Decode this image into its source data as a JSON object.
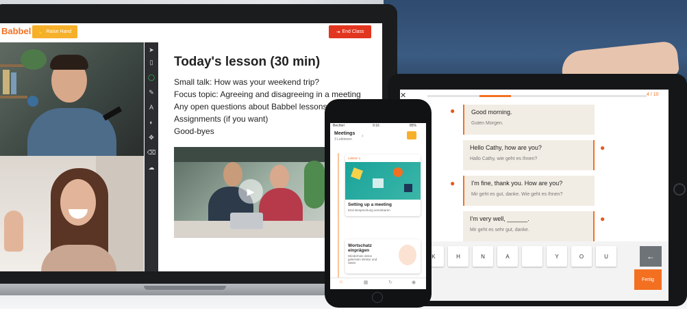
{
  "laptop": {
    "brand": "Babbel",
    "raise_hand": "Raise Hand",
    "end_class": "End Class",
    "lesson_title": "Today's lesson (30 min)",
    "agenda": [
      "Small talk: How was your weekend trip?",
      "Focus topic: Agreeing and disagreeing in a meeting",
      "Any open questions about Babbel lessons",
      "Assignments (if you want)",
      "Good-byes"
    ],
    "tools": [
      "cursor-icon",
      "file-icon",
      "record-icon",
      "pen-icon",
      "text-icon",
      "shape-icon",
      "move-icon",
      "eraser-icon",
      "upload-icon"
    ],
    "play_icon": "play-icon"
  },
  "phone": {
    "status_left": "Bechtel",
    "status_time": "9:16",
    "status_right": "85%",
    "header_title": "Meetings",
    "header_sub": "3 Lektionen",
    "card1_label": "Lektion 1",
    "card1_title": "Setting up a meeting",
    "card1_sub": "Eine Besprechung vereinbaren",
    "card2_title": "Wortschatz einprägen",
    "card2_sub": "Wiederhole deine gelernten Wörter und Sätze",
    "tabs": [
      "Home",
      "Kurse",
      "Wiederholen",
      "Profil"
    ]
  },
  "tablet": {
    "progress_label": "4 / 10",
    "progress_fraction": 0.4,
    "dialogue": [
      {
        "side": "left",
        "en": "Good morning.",
        "de": "Guten Morgen."
      },
      {
        "side": "right",
        "en": "Hello Cathy, how are you?",
        "de": "Hallo Cathy, wie geht es Ihnen?"
      },
      {
        "side": "left",
        "en": "I'm fine, thank you. How are you?",
        "de": "Mir geht es gut, danke. Wie geht es Ihnen?"
      },
      {
        "side": "right",
        "en": "I'm very well, ______.",
        "de": "Mir geht es sehr gut, danke."
      }
    ],
    "keys": [
      "K",
      "H",
      "N",
      "A",
      "",
      "Y",
      "O",
      "U"
    ],
    "backspace_icon": "←",
    "done_label": "Fertig"
  },
  "colors": {
    "brand_orange": "#f37021",
    "raise_hand": "#f6b02a",
    "end_class": "#e2351f"
  }
}
